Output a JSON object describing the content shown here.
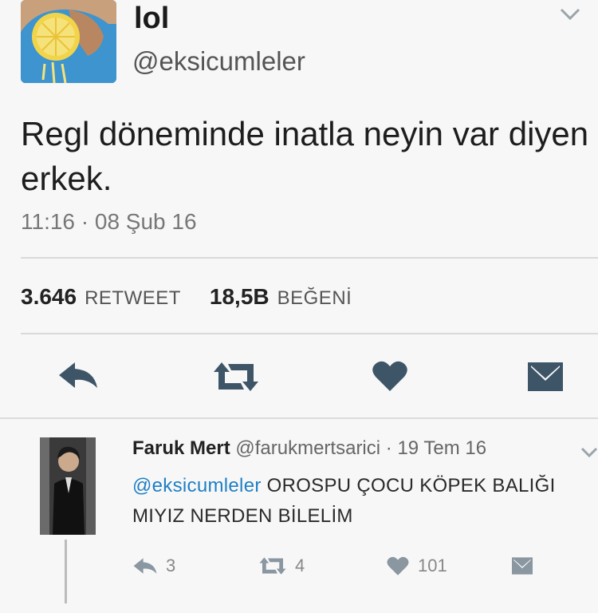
{
  "tweet": {
    "name": "lol",
    "handle": "@eksicumleler",
    "text": "Regl döneminde inatla neyin var diyen erkek.",
    "timestamp": "11:16 · 08 Şub 16",
    "retweets": {
      "count": "3.646",
      "label": "RETWEET"
    },
    "likes": {
      "count": "18,5B",
      "label": "BEĞENİ"
    },
    "actions": [
      "reply-icon",
      "retweet-icon",
      "heart-icon",
      "message-icon"
    ]
  },
  "reply": {
    "name": "Faruk Mert",
    "handle": "@farukmertsarici",
    "date": "· 19 Tem 16",
    "mention": "@eksicumleler",
    "text": " OROSPU ÇOCU KÖPEK BALIĞI MIYIZ NERDEN BİLELİM",
    "counts": {
      "replies": "3",
      "retweets": "4",
      "likes": "101"
    }
  },
  "colors": {
    "accent": "#1f7fc5",
    "avatar_bg": "#3d94cf",
    "icon": "#3e5568",
    "text": "#222222"
  }
}
